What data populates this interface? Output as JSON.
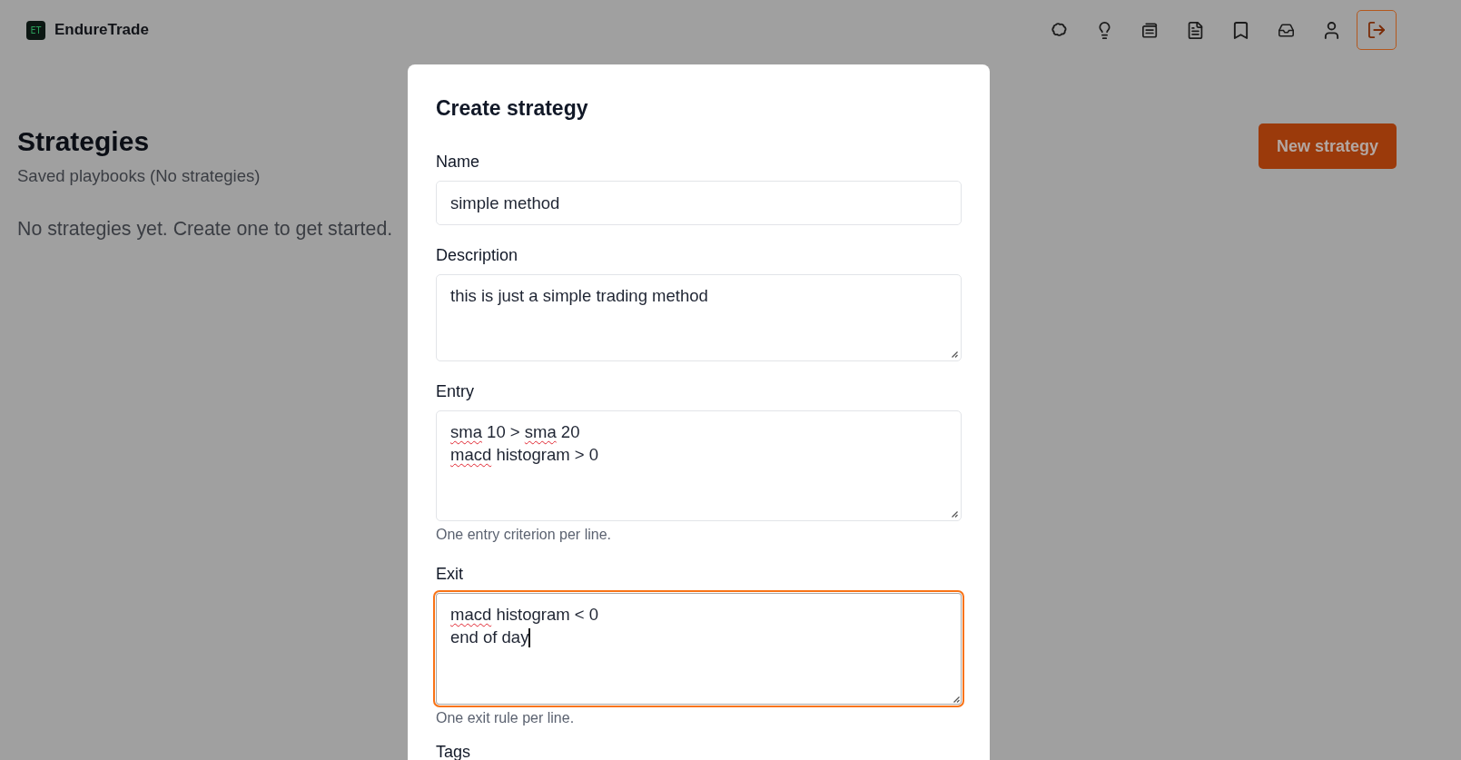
{
  "header": {
    "logo_text": "ET",
    "brand": "EndureTrade"
  },
  "page": {
    "title": "Strategies",
    "subtitle": "Saved playbooks (No strategies)",
    "empty_message": "No strategies yet. Create one to get started.",
    "new_button": "New strategy"
  },
  "dialog": {
    "title": "Create strategy",
    "fields": [
      {
        "kind": "input",
        "label": "Name",
        "value": "simple method",
        "focused": false
      },
      {
        "kind": "textarea",
        "label": "Description",
        "focused": false,
        "lines": [
          {
            "segments": [
              {
                "text": "this is just a simple trading method",
                "misspelled": false
              }
            ]
          }
        ]
      },
      {
        "kind": "textarea",
        "label": "Entry",
        "focused": false,
        "lines": [
          {
            "segments": [
              {
                "text": "sma",
                "misspelled": true
              },
              {
                "text": " 10 > ",
                "misspelled": false
              },
              {
                "text": "sma",
                "misspelled": true
              },
              {
                "text": " 20",
                "misspelled": false
              }
            ]
          },
          {
            "segments": [
              {
                "text": "macd",
                "misspelled": true
              },
              {
                "text": " histogram > 0",
                "misspelled": false
              }
            ]
          }
        ],
        "hint": "One entry criterion per line."
      },
      {
        "kind": "textarea",
        "label": "Exit",
        "focused": true,
        "lines": [
          {
            "segments": [
              {
                "text": "macd",
                "misspelled": true
              },
              {
                "text": " histogram < 0",
                "misspelled": false
              }
            ]
          },
          {
            "segments": [
              {
                "text": "end of day",
                "misspelled": false
              }
            ]
          }
        ],
        "hint": "One exit rule per line."
      },
      {
        "kind": "label",
        "label": "Tags"
      }
    ]
  }
}
